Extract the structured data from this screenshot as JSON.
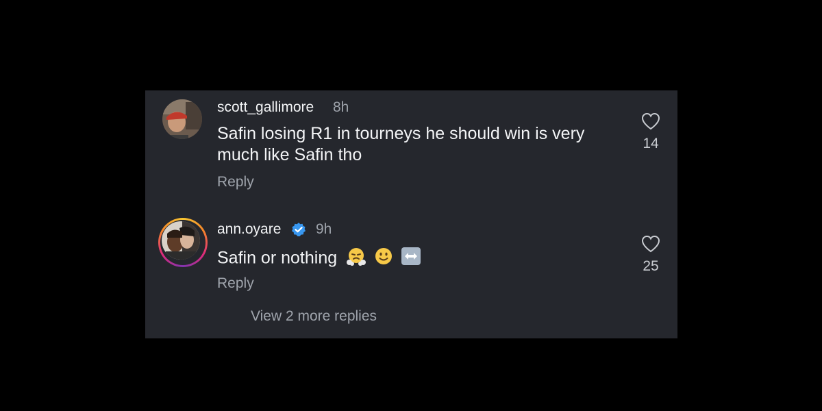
{
  "comments": [
    {
      "username": "scott_gallimore",
      "time": "8h",
      "text": "Safin losing R1 in tourneys he should win is very much like Safin tho",
      "reply_label": "Reply",
      "likes": "14",
      "verified": false,
      "avatar": "profile-photo"
    },
    {
      "username": "ann.oyare",
      "time": "9h",
      "text": "Safin or nothing",
      "emojis": [
        "face-with-steam-from-nose",
        "slightly-smiling-face",
        "left-right-arrow"
      ],
      "reply_label": "Reply",
      "likes": "25",
      "verified": true,
      "avatar": "profile-photo-with-story-ring"
    }
  ],
  "view_more_label": "View 2 more replies",
  "colors": {
    "background": "#000000",
    "panel": "#25272d",
    "primary_text": "#f3f4f6",
    "secondary_text": "#a0a5ad",
    "verified_badge": "#3897f0"
  }
}
